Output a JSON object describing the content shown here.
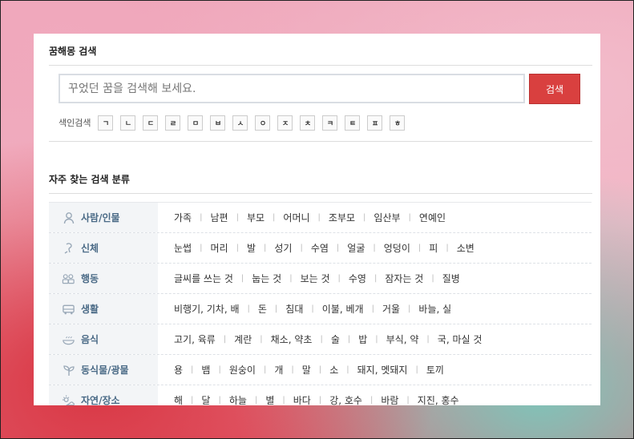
{
  "search": {
    "section_title": "꿈해몽 검색",
    "placeholder": "꾸었던 꿈을 검색해 보세요.",
    "button_label": "검색",
    "index_label": "색인검색",
    "index_keys": [
      "ㄱ",
      "ㄴ",
      "ㄷ",
      "ㄹ",
      "ㅁ",
      "ㅂ",
      "ㅅ",
      "ㅇ",
      "ㅈ",
      "ㅊ",
      "ㅋ",
      "ㅌ",
      "ㅍ",
      "ㅎ"
    ]
  },
  "categories": {
    "section_title": "자주 찾는 검색 분류",
    "rows": [
      {
        "label": "사람/인물",
        "icon": "person-icon",
        "items": [
          "가족",
          "남편",
          "부모",
          "어머니",
          "조부모",
          "임산부",
          "연예인"
        ]
      },
      {
        "label": "신체",
        "icon": "body-icon",
        "items": [
          "눈썹",
          "머리",
          "발",
          "성기",
          "수염",
          "얼굴",
          "엉덩이",
          "피",
          "소변"
        ]
      },
      {
        "label": "행동",
        "icon": "action-icon",
        "items": [
          "글씨를 쓰는 것",
          "눕는 것",
          "보는 것",
          "수영",
          "잠자는 것",
          "질병"
        ]
      },
      {
        "label": "생활",
        "icon": "vehicle-icon",
        "items": [
          "비행기, 기차, 배",
          "돈",
          "침대",
          "이불, 베개",
          "거울",
          "바늘, 실"
        ]
      },
      {
        "label": "음식",
        "icon": "food-icon",
        "items": [
          "고기, 육류",
          "계란",
          "채소, 약초",
          "술",
          "밥",
          "부식, 약",
          "국, 마실 것"
        ]
      },
      {
        "label": "동식물/광물",
        "icon": "plant-icon",
        "items": [
          "용",
          "뱀",
          "원숭이",
          "개",
          "말",
          "소",
          "돼지, 멧돼지",
          "토끼"
        ]
      },
      {
        "label": "자연/장소",
        "icon": "nature-icon",
        "items": [
          "해",
          "달",
          "하늘",
          "별",
          "바다",
          "강, 호수",
          "바람",
          "지진, 홍수"
        ]
      }
    ]
  },
  "colors": {
    "accent": "#d9403f",
    "category_text": "#4a6a86"
  }
}
